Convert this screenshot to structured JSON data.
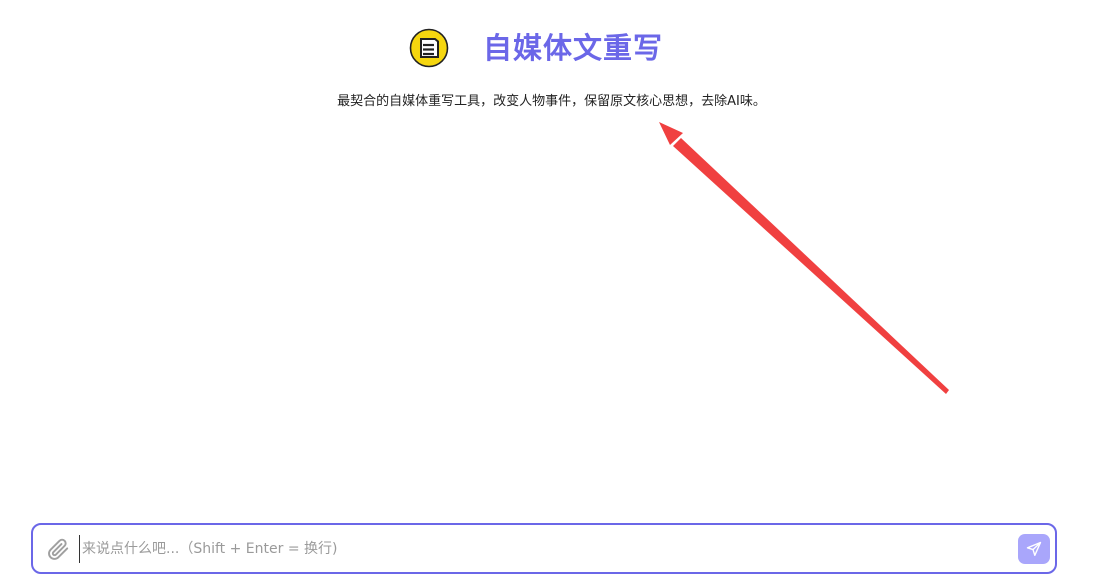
{
  "theme": {
    "accent": "#6b67e8",
    "send_bg": "#a9a6fb",
    "arrow": "#f04040",
    "logo_fill": "#f5d60f"
  },
  "header": {
    "logo_icon": "note-badge-icon",
    "title": "自媒体文重写",
    "subtitle": "最契合的自媒体重写工具，改变人物事件，保留原文核心思想，去除AI味。"
  },
  "composer": {
    "attach_icon": "paperclip-icon",
    "placeholder": "来说点什么吧...（Shift + Enter = 换行)",
    "value": "",
    "send_icon": "send-arrow-icon"
  }
}
